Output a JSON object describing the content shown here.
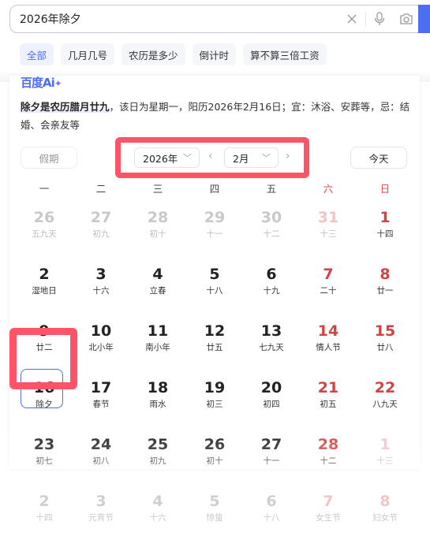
{
  "search": {
    "query": "2026年除夕",
    "clear_icon": "close-icon",
    "voice_icon": "microphone-icon",
    "camera_icon": "camera-icon",
    "button_color": "#4e6ef2"
  },
  "tabs": [
    {
      "label": "全部",
      "active": true
    },
    {
      "label": "几月几号",
      "active": false
    },
    {
      "label": "农历是多少",
      "active": false
    },
    {
      "label": "倒计时",
      "active": false
    },
    {
      "label": "算不算三倍工资",
      "active": false
    }
  ],
  "ai": {
    "logo_text": "百度Ai",
    "logo_star": "✦",
    "summary_bold": "除夕是农历腊月廿九",
    "summary_rest": "，该日为星期一，阳历2026年2月16日；宜：沐浴、安葬等，忌：结婚、会亲友等"
  },
  "calendar": {
    "holiday_button": "假期",
    "year_select": "2026年",
    "month_select": "2月",
    "prev_label": "‹",
    "next_label": "›",
    "today_button": "今天",
    "weekdays": [
      "一",
      "二",
      "三",
      "四",
      "五",
      "六",
      "日"
    ],
    "weeks": [
      [
        {
          "d": "26",
          "l": "五九天",
          "s": "out"
        },
        {
          "d": "27",
          "l": "初九",
          "s": "out"
        },
        {
          "d": "28",
          "l": "初十",
          "s": "out"
        },
        {
          "d": "29",
          "l": "十一",
          "s": "out"
        },
        {
          "d": "30",
          "l": "十二",
          "s": "out"
        },
        {
          "d": "31",
          "l": "十三",
          "s": "out"
        },
        {
          "d": "1",
          "l": "十四",
          "s": "cur"
        }
      ],
      [
        {
          "d": "2",
          "l": "湿地日",
          "s": "cur"
        },
        {
          "d": "3",
          "l": "十六",
          "s": "cur"
        },
        {
          "d": "4",
          "l": "立春",
          "s": "cur"
        },
        {
          "d": "5",
          "l": "十八",
          "s": "cur"
        },
        {
          "d": "6",
          "l": "十九",
          "s": "cur"
        },
        {
          "d": "7",
          "l": "二十",
          "s": "cur"
        },
        {
          "d": "8",
          "l": "廿一",
          "s": "cur"
        }
      ],
      [
        {
          "d": "9",
          "l": "廿二",
          "s": "cur"
        },
        {
          "d": "10",
          "l": "北小年",
          "s": "cur"
        },
        {
          "d": "11",
          "l": "南小年",
          "s": "cur"
        },
        {
          "d": "12",
          "l": "廿五",
          "s": "cur"
        },
        {
          "d": "13",
          "l": "七九天",
          "s": "cur"
        },
        {
          "d": "14",
          "l": "情人节",
          "s": "cur"
        },
        {
          "d": "15",
          "l": "廿八",
          "s": "cur"
        }
      ],
      [
        {
          "d": "16",
          "l": "除夕",
          "s": "selected"
        },
        {
          "d": "17",
          "l": "春节",
          "s": "cur"
        },
        {
          "d": "18",
          "l": "雨水",
          "s": "cur"
        },
        {
          "d": "19",
          "l": "初三",
          "s": "cur"
        },
        {
          "d": "20",
          "l": "初四",
          "s": "cur"
        },
        {
          "d": "21",
          "l": "初五",
          "s": "cur"
        },
        {
          "d": "22",
          "l": "八九天",
          "s": "cur"
        }
      ],
      [
        {
          "d": "23",
          "l": "初七",
          "s": "cur"
        },
        {
          "d": "24",
          "l": "初八",
          "s": "cur"
        },
        {
          "d": "25",
          "l": "初九",
          "s": "cur"
        },
        {
          "d": "26",
          "l": "初十",
          "s": "cur"
        },
        {
          "d": "27",
          "l": "十一",
          "s": "cur"
        },
        {
          "d": "28",
          "l": "十二",
          "s": "cur"
        },
        {
          "d": "1",
          "l": "十三",
          "s": "out"
        }
      ],
      [
        {
          "d": "2",
          "l": "十四",
          "s": "fade"
        },
        {
          "d": "3",
          "l": "元宵节",
          "s": "fade"
        },
        {
          "d": "4",
          "l": "十六",
          "s": "fade"
        },
        {
          "d": "5",
          "l": "惊蛰",
          "s": "fade"
        },
        {
          "d": "6",
          "l": "十八",
          "s": "fade"
        },
        {
          "d": "7",
          "l": "女生节",
          "s": "fade"
        },
        {
          "d": "8",
          "l": "妇女节",
          "s": "fade"
        }
      ]
    ]
  },
  "colors": {
    "accent": "#4e6ef2",
    "weekend": "#d04444",
    "highlight_box": "#ff5468"
  }
}
